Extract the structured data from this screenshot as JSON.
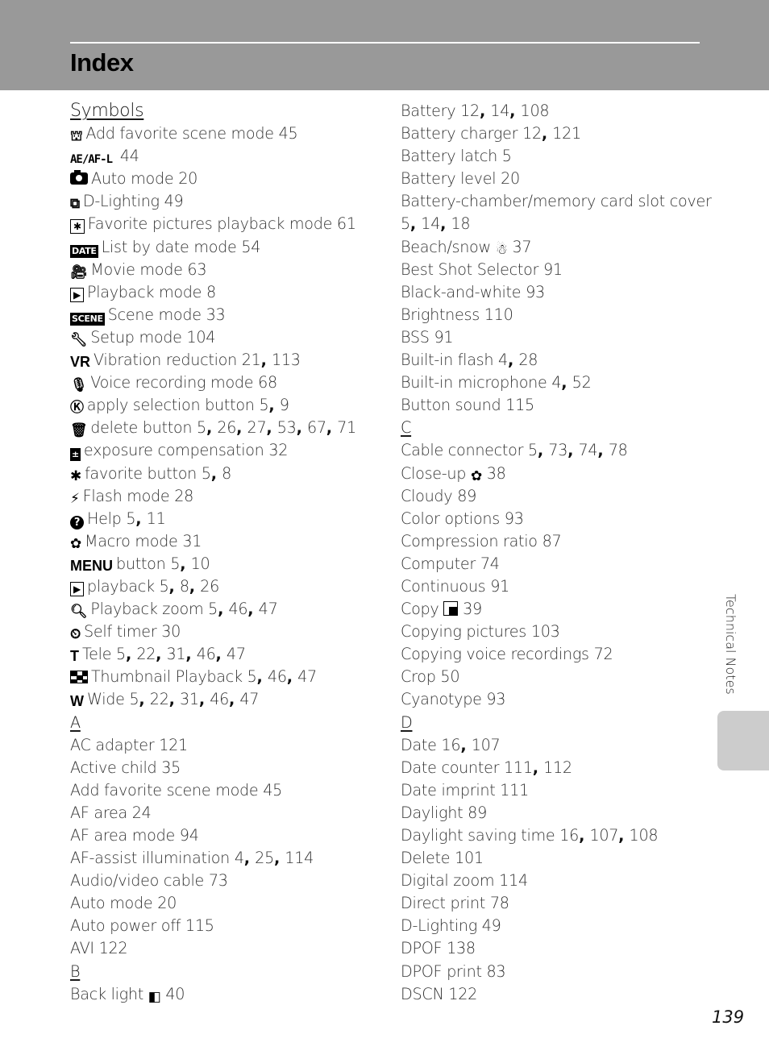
{
  "header": {
    "title": "Index"
  },
  "side_tab": {
    "label": "Technical Notes"
  },
  "footer": {
    "page_number": "139"
  },
  "left_column": [
    {
      "type": "heading",
      "text": "Symbols"
    },
    {
      "type": "entry",
      "icon": "add-favorite-scene-icon",
      "glyph": "⛫",
      "icon_style": "plain",
      "text": "Add favorite scene mode",
      "pages": [
        "45"
      ]
    },
    {
      "type": "entry",
      "icon": "ae-af-lock-icon",
      "glyph": "AE/AF-L",
      "icon_style": "outline-text",
      "text": "",
      "pages": [
        "44"
      ]
    },
    {
      "type": "entry",
      "icon": "camera-icon",
      "glyph": "",
      "icon_style": "camera",
      "text": "Auto mode",
      "pages": [
        "20"
      ]
    },
    {
      "type": "entry",
      "icon": "d-lighting-icon",
      "glyph": "⧉",
      "icon_style": "plain",
      "text": "D-Lighting",
      "pages": [
        "49"
      ]
    },
    {
      "type": "entry",
      "icon": "favorite-pictures-icon",
      "glyph": "✱",
      "icon_style": "box",
      "text": "Favorite pictures playback mode",
      "pages": [
        "61"
      ]
    },
    {
      "type": "entry",
      "icon": "list-by-date-icon",
      "glyph": "DATE",
      "icon_style": "solid",
      "text": "List by date mode",
      "pages": [
        "54"
      ]
    },
    {
      "type": "entry",
      "icon": "movie-camera-icon",
      "glyph": "🎥︎",
      "icon_style": "plain",
      "text": "Movie mode",
      "pages": [
        "63"
      ]
    },
    {
      "type": "entry",
      "icon": "playback-icon",
      "glyph": "▶",
      "icon_style": "box",
      "text": "Playback mode",
      "pages": [
        "8"
      ]
    },
    {
      "type": "entry",
      "icon": "scene-icon",
      "glyph": "SCENE",
      "icon_style": "solid",
      "text": "Scene mode",
      "pages": [
        "33"
      ]
    },
    {
      "type": "entry",
      "icon": "setup-wrench-icon",
      "glyph": "🔧︎",
      "icon_style": "plain",
      "text": "Setup mode",
      "pages": [
        "104"
      ]
    },
    {
      "type": "entry",
      "icon": "vibration-reduction-icon",
      "glyph": "VR",
      "icon_style": "wide-text",
      "text": "Vibration reduction",
      "pages": [
        "21",
        "113"
      ]
    },
    {
      "type": "entry",
      "icon": "microphone-icon",
      "glyph": "🎙︎",
      "icon_style": "plain",
      "text": "Voice recording mode",
      "pages": [
        "68"
      ]
    },
    {
      "type": "entry",
      "icon": "ok-button-icon",
      "glyph": "Ⓚ",
      "icon_style": "plain",
      "text": "apply selection button",
      "pages": [
        "5",
        "9"
      ]
    },
    {
      "type": "entry",
      "icon": "trash-icon",
      "glyph": "🗑︎",
      "icon_style": "plain",
      "text": "delete button",
      "pages": [
        "5",
        "26",
        "27",
        "53",
        "67",
        "71"
      ]
    },
    {
      "type": "entry",
      "icon": "exposure-compensation-icon",
      "glyph": "±",
      "icon_style": "solid",
      "text": "exposure compensation",
      "pages": [
        "32"
      ]
    },
    {
      "type": "entry",
      "icon": "favorite-asterisk-icon",
      "glyph": "✱",
      "icon_style": "plain",
      "text": "favorite button",
      "pages": [
        "5",
        "8"
      ]
    },
    {
      "type": "entry",
      "icon": "flash-icon",
      "glyph": "⚡︎",
      "icon_style": "plain",
      "text": "Flash mode",
      "pages": [
        "28"
      ]
    },
    {
      "type": "entry",
      "icon": "help-icon",
      "glyph": "?",
      "icon_style": "circle",
      "text": "Help",
      "pages": [
        "5",
        "11"
      ]
    },
    {
      "type": "entry",
      "icon": "macro-flower-icon",
      "glyph": "✿",
      "icon_style": "plain",
      "text": "Macro mode",
      "pages": [
        "31"
      ]
    },
    {
      "type": "entry",
      "icon": "menu-icon",
      "glyph": "MENU",
      "icon_style": "wide-text",
      "text": "button",
      "pages": [
        "5",
        "10"
      ]
    },
    {
      "type": "entry",
      "icon": "playback-icon",
      "glyph": "▶",
      "icon_style": "box",
      "text": "playback",
      "pages": [
        "5",
        "8",
        "26"
      ]
    },
    {
      "type": "entry",
      "icon": "zoom-magnifier-icon",
      "glyph": "🔍︎",
      "icon_style": "plain",
      "text": "Playback zoom",
      "pages": [
        "5",
        "46",
        "47"
      ]
    },
    {
      "type": "entry",
      "icon": "self-timer-icon",
      "glyph": "⏲︎",
      "icon_style": "plain",
      "text": "Self timer",
      "pages": [
        "30"
      ]
    },
    {
      "type": "entry",
      "icon": "tele-icon",
      "glyph": "T",
      "icon_style": "wide-text",
      "text": "Tele",
      "pages": [
        "5",
        "22",
        "31",
        "46",
        "47"
      ]
    },
    {
      "type": "entry",
      "icon": "thumbnail-icon",
      "glyph": "",
      "icon_style": "checker",
      "text": "Thumbnail Playback",
      "pages": [
        "5",
        "46",
        "47"
      ]
    },
    {
      "type": "entry",
      "icon": "wide-icon",
      "glyph": "W",
      "icon_style": "wide-text",
      "text": "Wide",
      "pages": [
        "5",
        "22",
        "31",
        "46",
        "47"
      ]
    },
    {
      "type": "heading",
      "text": "A"
    },
    {
      "type": "entry",
      "text": "AC adapter",
      "pages": [
        "121"
      ]
    },
    {
      "type": "entry",
      "text": "Active child",
      "pages": [
        "35"
      ]
    },
    {
      "type": "entry",
      "text": "Add favorite scene mode",
      "pages": [
        "45"
      ]
    },
    {
      "type": "entry",
      "text": "AF area",
      "pages": [
        "24"
      ]
    },
    {
      "type": "entry",
      "text": "AF area mode",
      "pages": [
        "94"
      ]
    },
    {
      "type": "entry",
      "text": "AF-assist illumination",
      "pages": [
        "4",
        "25",
        "114"
      ]
    },
    {
      "type": "entry",
      "text": "Audio/video cable",
      "pages": [
        "73"
      ]
    },
    {
      "type": "entry",
      "text": "Auto mode",
      "pages": [
        "20"
      ]
    },
    {
      "type": "entry",
      "text": "Auto power off",
      "pages": [
        "115"
      ]
    },
    {
      "type": "entry",
      "text": "AVI",
      "pages": [
        "122"
      ]
    },
    {
      "type": "heading",
      "text": "B"
    },
    {
      "type": "entry",
      "text": "Back light",
      "trailing_icon": "backlight-icon",
      "trailing_glyph": "◧",
      "pages": [
        "40"
      ]
    }
  ],
  "right_column": [
    {
      "type": "entry",
      "text": "Battery",
      "pages": [
        "12",
        "14",
        "108"
      ]
    },
    {
      "type": "entry",
      "text": "Battery charger",
      "pages": [
        "12",
        "121"
      ]
    },
    {
      "type": "entry",
      "text": "Battery latch",
      "pages": [
        "5"
      ]
    },
    {
      "type": "entry",
      "text": "Battery level",
      "pages": [
        "20"
      ]
    },
    {
      "type": "entry",
      "text": "Battery-chamber/memory card slot cover",
      "pages": []
    },
    {
      "type": "entry",
      "text": "",
      "pages": [
        "5",
        "14",
        "18"
      ]
    },
    {
      "type": "entry",
      "text": "Beach/snow",
      "trailing_icon": "beach-snow-icon",
      "trailing_glyph": "☃",
      "pages": [
        "37"
      ]
    },
    {
      "type": "entry",
      "text": "Best Shot Selector",
      "pages": [
        "91"
      ]
    },
    {
      "type": "entry",
      "text": "Black-and-white",
      "pages": [
        "93"
      ]
    },
    {
      "type": "entry",
      "text": "Brightness",
      "pages": [
        "110"
      ]
    },
    {
      "type": "entry",
      "text": "BSS",
      "pages": [
        "91"
      ]
    },
    {
      "type": "entry",
      "text": "Built-in flash",
      "pages": [
        "4",
        "28"
      ]
    },
    {
      "type": "entry",
      "text": "Built-in microphone",
      "pages": [
        "4",
        "52"
      ]
    },
    {
      "type": "entry",
      "text": "Button sound",
      "pages": [
        "115"
      ]
    },
    {
      "type": "heading",
      "text": "C"
    },
    {
      "type": "entry",
      "text": "Cable connector",
      "pages": [
        "5",
        "73",
        "74",
        "78"
      ]
    },
    {
      "type": "entry",
      "text": "Close-up",
      "trailing_icon": "close-up-flower-icon",
      "trailing_glyph": "✿",
      "pages": [
        "38"
      ]
    },
    {
      "type": "entry",
      "text": "Cloudy",
      "pages": [
        "89"
      ]
    },
    {
      "type": "entry",
      "text": "Color options",
      "pages": [
        "93"
      ]
    },
    {
      "type": "entry",
      "text": "Compression ratio",
      "pages": [
        "87"
      ]
    },
    {
      "type": "entry",
      "text": "Computer",
      "pages": [
        "74"
      ]
    },
    {
      "type": "entry",
      "text": "Continuous",
      "pages": [
        "91"
      ]
    },
    {
      "type": "entry",
      "text": "Copy",
      "trailing_icon": "copy-icon",
      "trailing_glyph": "",
      "pages": [
        "39"
      ]
    },
    {
      "type": "entry",
      "text": "Copying pictures",
      "pages": [
        "103"
      ]
    },
    {
      "type": "entry",
      "text": "Copying voice recordings",
      "pages": [
        "72"
      ]
    },
    {
      "type": "entry",
      "text": "Crop",
      "pages": [
        "50"
      ]
    },
    {
      "type": "entry",
      "text": "Cyanotype",
      "pages": [
        "93"
      ]
    },
    {
      "type": "heading",
      "text": "D"
    },
    {
      "type": "entry",
      "text": "Date",
      "pages": [
        "16",
        "107"
      ]
    },
    {
      "type": "entry",
      "text": "Date counter",
      "pages": [
        "111",
        "112"
      ]
    },
    {
      "type": "entry",
      "text": "Date imprint",
      "pages": [
        "111"
      ]
    },
    {
      "type": "entry",
      "text": "Daylight",
      "pages": [
        "89"
      ]
    },
    {
      "type": "entry",
      "text": "Daylight saving time",
      "pages": [
        "16",
        "107",
        "108"
      ]
    },
    {
      "type": "entry",
      "text": "Delete",
      "pages": [
        "101"
      ]
    },
    {
      "type": "entry",
      "text": "Digital zoom",
      "pages": [
        "114"
      ]
    },
    {
      "type": "entry",
      "text": "Direct print",
      "pages": [
        "78"
      ]
    },
    {
      "type": "entry",
      "text": "D-Lighting",
      "pages": [
        "49"
      ]
    },
    {
      "type": "entry",
      "text": "DPOF",
      "pages": [
        "138"
      ]
    },
    {
      "type": "entry",
      "text": "DPOF print",
      "pages": [
        "83"
      ]
    },
    {
      "type": "entry",
      "text": "DSCN",
      "pages": [
        "122"
      ]
    }
  ]
}
